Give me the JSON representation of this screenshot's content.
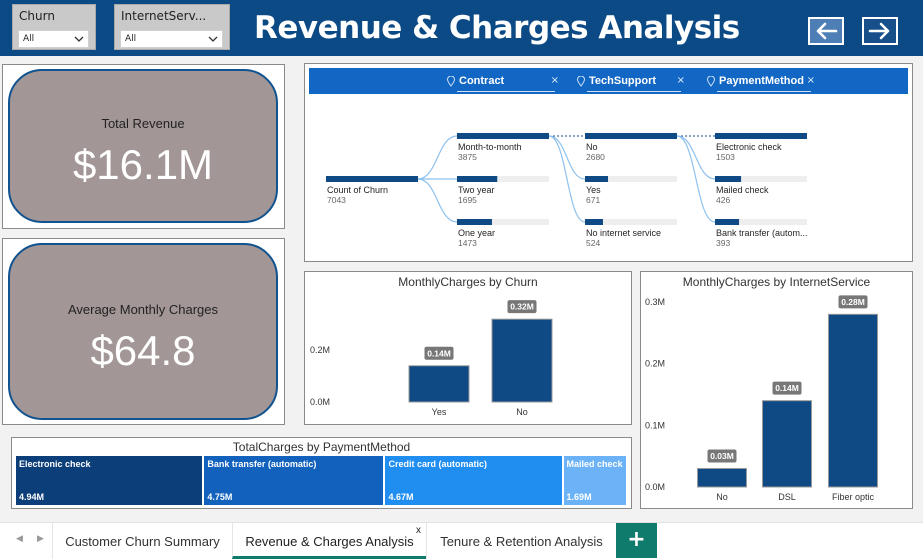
{
  "filters": [
    {
      "title": "Churn",
      "value": "All"
    },
    {
      "title": "InternetServ...",
      "value": "All"
    }
  ],
  "page_title": "Revenue & Charges Analysis",
  "nav": {
    "back_icon": "arrow-left-icon",
    "next_icon": "arrow-right-icon"
  },
  "kpis": {
    "total_revenue": {
      "label": "Total Revenue",
      "value": "$16.1M"
    },
    "avg_monthly": {
      "label": "Average Monthly Charges",
      "value": "$64.8"
    }
  },
  "decomposition_tree": {
    "levels": [
      "Contract",
      "TechSupport",
      "PaymentMethod"
    ],
    "root": {
      "label": "Count of Churn",
      "value": 7043
    },
    "contract": [
      {
        "label": "Month-to-month",
        "value": 3875
      },
      {
        "label": "Two year",
        "value": 1695
      },
      {
        "label": "One year",
        "value": 1473
      }
    ],
    "techsupport": [
      {
        "label": "No",
        "value": 2680
      },
      {
        "label": "Yes",
        "value": 671
      },
      {
        "label": "No internet service",
        "value": 524
      }
    ],
    "payment": [
      {
        "label": "Electronic check",
        "value": 1503
      },
      {
        "label": "Mailed check",
        "value": 426
      },
      {
        "label": "Bank transfer (autom...",
        "value": 393
      }
    ],
    "colors": {
      "bar": "#0f4a85",
      "track": "#eeeeee",
      "link": "#8ec1ee"
    }
  },
  "chart_data": [
    {
      "type": "bar",
      "title": "MonthlyCharges by Churn",
      "categories": [
        "Yes",
        "No"
      ],
      "values": [
        0.14,
        0.32
      ],
      "value_labels": [
        "0.14M",
        "0.32M"
      ],
      "y_ticks": [
        "0.0M",
        "0.2M"
      ],
      "ylim": [
        0,
        0.34
      ],
      "color": "#0f4a85"
    },
    {
      "type": "bar",
      "title": "MonthlyCharges by InternetService",
      "categories": [
        "No",
        "DSL",
        "Fiber optic"
      ],
      "values": [
        0.03,
        0.14,
        0.28
      ],
      "value_labels": [
        "0.03M",
        "0.14M",
        "0.28M"
      ],
      "y_ticks": [
        "0.0M",
        "0.1M",
        "0.2M",
        "0.3M"
      ],
      "ylim": [
        0,
        0.3
      ],
      "color": "#0f4a85"
    },
    {
      "type": "treemap",
      "title": "TotalCharges by PaymentMethod",
      "items": [
        {
          "label": "Electronic check",
          "value": 4.94,
          "value_label": "4.94M",
          "color": "#0c3f79"
        },
        {
          "label": "Bank transfer (automatic)",
          "value": 4.75,
          "value_label": "4.75M",
          "color": "#1262bd"
        },
        {
          "label": "Credit card (automatic)",
          "value": 4.67,
          "value_label": "4.67M",
          "color": "#1f8ef0"
        },
        {
          "label": "Mailed check",
          "value": 1.69,
          "value_label": "1.69M",
          "color": "#6bb2f6"
        }
      ]
    }
  ],
  "tabs": [
    {
      "label": "Customer Churn Summary",
      "active": false
    },
    {
      "label": "Revenue & Charges Analysis",
      "active": true,
      "close": "x"
    },
    {
      "label": "Tenure & Retention Analysis",
      "active": false
    }
  ],
  "add_tab_label": "+",
  "tab_nav": {
    "prev": "◀",
    "next": "▶"
  }
}
